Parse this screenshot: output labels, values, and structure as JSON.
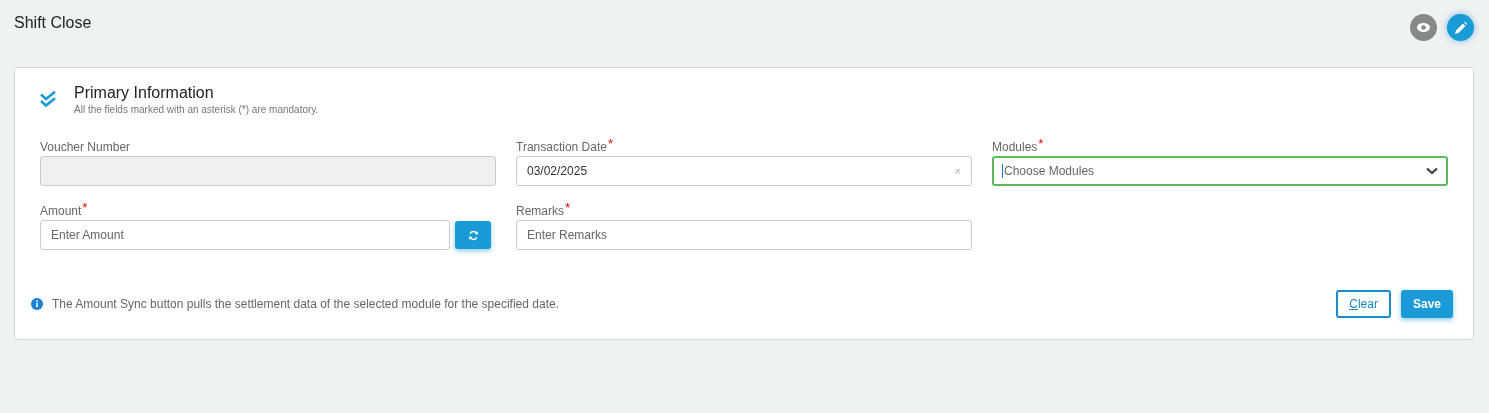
{
  "page": {
    "title": "Shift Close"
  },
  "header_actions": [
    {
      "kind": "view"
    },
    {
      "kind": "edit"
    }
  ],
  "section": {
    "title": "Primary Information",
    "subtitle": "All the fields marked with an asterisk (*) are mandatory."
  },
  "fields": [
    {
      "kind": "text",
      "label": "Voucher Number",
      "disabled": true,
      "focused": false
    },
    {
      "kind": "date",
      "label": "Transaction Date",
      "required_mark": "*",
      "disabled": false,
      "focused": false,
      "value": "03/02/2025",
      "clear": "×"
    },
    {
      "kind": "select",
      "label": "Modules",
      "required_mark": "*",
      "disabled": false,
      "focused": true,
      "placeholder": "Choose Modules"
    },
    {
      "kind": "sync",
      "label": "Amount",
      "required_mark": "*",
      "disabled": false,
      "focused": false,
      "placeholder": "Enter Amount"
    },
    {
      "kind": "text",
      "label": "Remarks",
      "required_mark": "*",
      "disabled": false,
      "focused": false,
      "placeholder": "Enter Remarks"
    }
  ],
  "note": "The Amount Sync button pulls the settlement data of the selected module for the specified date.",
  "buttons": [
    {
      "kind": "outline",
      "label": "Clear"
    },
    {
      "kind": "primary",
      "label": "Save"
    }
  ]
}
